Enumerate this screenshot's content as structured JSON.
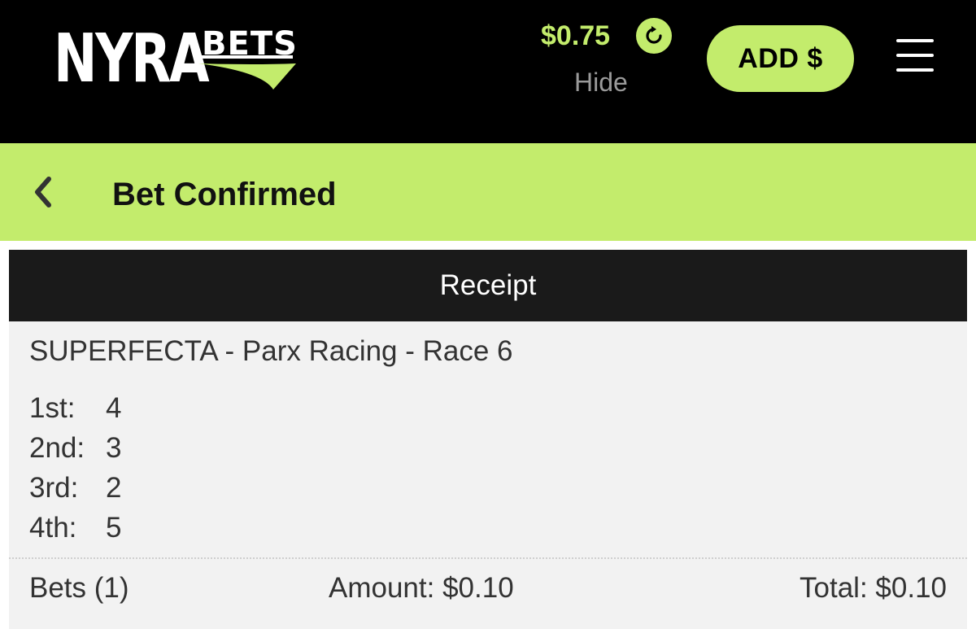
{
  "header": {
    "logo_nyra": "NYRA",
    "logo_bets": "BETS",
    "balance": "$0.75",
    "hide_label": "Hide",
    "add_funds_label": "ADD $"
  },
  "titlebar": {
    "title": "Bet Confirmed"
  },
  "receipt": {
    "heading": "Receipt",
    "bet_description": "SUPERFECTA - Parx Racing - Race 6",
    "positions": [
      {
        "label": "1st:",
        "value": "4"
      },
      {
        "label": "2nd:",
        "value": "3"
      },
      {
        "label": "3rd:",
        "value": "2"
      },
      {
        "label": "4th:",
        "value": "5"
      }
    ],
    "bets_count": "Bets (1)",
    "amount": "Amount: $0.10",
    "total": "Total: $0.10"
  },
  "colors": {
    "brand_green": "#c3ec6c",
    "header_black": "#000000",
    "receipt_head": "#1a1a1a",
    "receipt_bg": "#f2f2f2"
  },
  "icons": [
    "refresh-icon",
    "chevron-left-icon",
    "hamburger-menu-icon"
  ]
}
